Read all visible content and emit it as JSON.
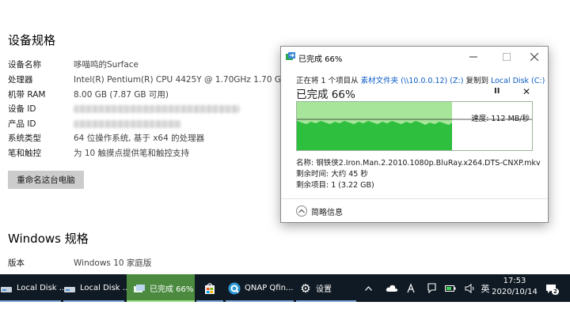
{
  "settings": {
    "device_specs_title": "设备规格",
    "rows": [
      {
        "label": "设备名称",
        "value": "哆喵鸣的Surface"
      },
      {
        "label": "处理器",
        "value": "Intel(R) Pentium(R) CPU 4425Y @ 1.70GHz   1.70 GHz"
      },
      {
        "label": "机带 RAM",
        "value": "8.00 GB (7.87 GB 可用)"
      },
      {
        "label": "设备 ID",
        "value": ""
      },
      {
        "label": "产品 ID",
        "value": ""
      },
      {
        "label": "系统类型",
        "value": "64 位操作系统, 基于 x64 的处理器"
      },
      {
        "label": "笔和触控",
        "value": "为 10 触摸点提供笔和触控支持"
      }
    ],
    "rename_button": "重命名这台电脑",
    "windows_specs_title": "Windows 规格",
    "edition_label": "版本",
    "edition_value": "Windows 10 家庭版"
  },
  "copy_dialog": {
    "title": "已完成 66%",
    "copy_prefix": "正在将 1 个项目从 ",
    "source": "素材文件夹 (\\\\10.0.0.12) (Z:)",
    "copy_middle": " 复制到 ",
    "destination": "Local Disk (C:)",
    "percent_heading": "已完成 66%",
    "pause_glyph": "II",
    "close_glyph": "✕",
    "speed_label": "速度: 112 MB/秒",
    "progress_fraction": 0.66,
    "name_line": "名称: 钢铁侠2.Iron.Man.2.2010.1080p.BluRay.x264.DTS-CNXP.mkv",
    "time_left_line": "剩余时间: 大约 45 秒",
    "items_left_line": "剩余项目: 1 (3.22 GB)",
    "less_info": "简略信息",
    "colors": {
      "graph_fill": "#2fbf3f",
      "graph_bg": "#a6e59a"
    }
  },
  "taskbar": {
    "apps": [
      {
        "label": "Local Disk ...",
        "icon": "drive-icon"
      },
      {
        "label": "Local Disk ...",
        "icon": "drive-icon"
      },
      {
        "label": "已完成 66%",
        "icon": "copy-progress-icon"
      },
      {
        "label": "",
        "icon": "store-icon"
      },
      {
        "label": "QNAP Qfin...",
        "icon": "qnap-icon"
      },
      {
        "label": "设置",
        "icon": "gear-icon"
      }
    ],
    "ime": "英",
    "time": "17:53",
    "date": "2020/10/14",
    "notification_count": "2"
  }
}
